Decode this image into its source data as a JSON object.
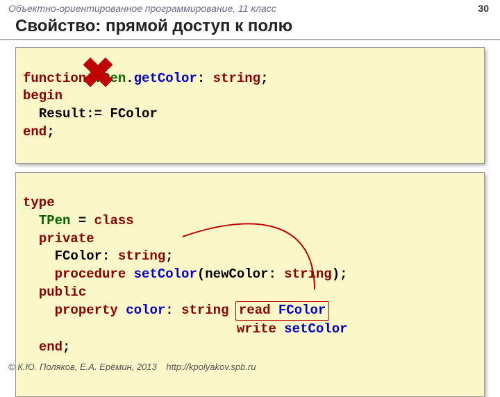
{
  "header": {
    "course": "Объектно-ориентированное программирование, 11 класс",
    "page_number": "30"
  },
  "title": "Свойство: прямой доступ к полю",
  "code1": {
    "l1_function": "function ",
    "l1_class": "TPen",
    "l1_dot": ".",
    "l1_method": "getColor",
    "l1_colon": ": ",
    "l1_type": "string",
    "l1_semi": ";",
    "l2_begin": "begin",
    "l3_indent": "  ",
    "l3_result": "Result:= FColor",
    "l4_end": "end",
    "l4_semi": ";"
  },
  "code2": {
    "l1_type": "type",
    "l2_indent": "  ",
    "l2_class": "TPen",
    "l2_eq": " = ",
    "l2_kw": "class",
    "l3_indent": "  ",
    "l3_kw": "private",
    "l4_indent": "    ",
    "l4_field": "FColor: ",
    "l4_type": "string",
    "l4_semi": ";",
    "l5_indent": "    ",
    "l5_proc": "procedure",
    "l5_sp": " ",
    "l5_name": "setColor",
    "l5_open": "(newColor: ",
    "l5_type": "string",
    "l5_close": ");",
    "l6_indent": "  ",
    "l6_kw": "public",
    "l7_indent": "    ",
    "l7_prop": "property",
    "l7_sp": " ",
    "l7_name": "color",
    "l7_colon": ": ",
    "l7_type": "string",
    "l7_sp2": " ",
    "l7_read": "read",
    "l7_sp3": " ",
    "l7_fcolor": "FColor",
    "l8_indent": "                           ",
    "l8_write": "write",
    "l8_sp": " ",
    "l8_setcolor": "setColor",
    "l9_indent": "  ",
    "l9_end": "end",
    "l9_semi": ";"
  },
  "footer": {
    "copyright": "© К.Ю. Поляков, Е.А. Ерёмин, 2013",
    "url": "http://kpolyakov.spb.ru"
  },
  "icons": {
    "cross": "cross-icon"
  }
}
